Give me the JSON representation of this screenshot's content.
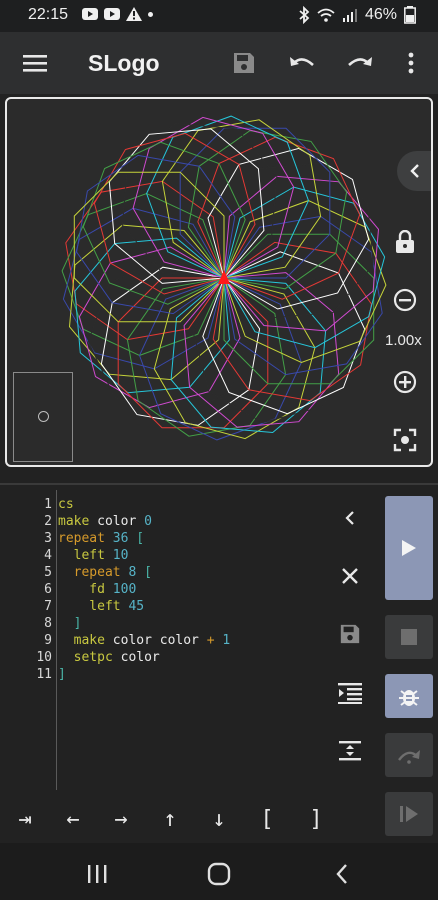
{
  "status": {
    "time": "22:15",
    "battery": "46%",
    "left_icons": [
      "youtube-icon",
      "youtube-icon",
      "warning-icon",
      "dot-icon"
    ],
    "right_icons": [
      "bluetooth-icon",
      "wifi-icon",
      "signal-icon",
      "battery-icon"
    ]
  },
  "appbar": {
    "title": "SLogo",
    "icons": [
      "menu-icon",
      "save-icon",
      "undo-icon",
      "redo-icon",
      "more-vert-icon"
    ]
  },
  "canvas": {
    "zoom": "1.00x",
    "colors": [
      "#e53935",
      "#43a047",
      "#3949ab",
      "#c6d43a",
      "#26c6da",
      "#d14ad1",
      "#2c2c2c",
      "#ffffff"
    ],
    "turtle_color": "#ff1a1a",
    "repeat_outer": 36,
    "left_angle": 10,
    "repeat_inner": 8,
    "forward": 100,
    "turn": 45
  },
  "editor": {
    "lines": [
      {
        "num": "1",
        "tokens": [
          {
            "t": "cs",
            "c": "kw"
          }
        ]
      },
      {
        "num": "2",
        "tokens": [
          {
            "t": "make",
            "c": "kw"
          },
          {
            "t": " color ",
            "c": "w"
          },
          {
            "t": "0",
            "c": "n"
          }
        ]
      },
      {
        "num": "3",
        "tokens": [
          {
            "t": "repeat",
            "c": "cmd"
          },
          {
            "t": " ",
            "c": "w"
          },
          {
            "t": "36",
            "c": "n"
          },
          {
            "t": " [",
            "c": "br"
          }
        ]
      },
      {
        "num": "4",
        "tokens": [
          {
            "t": "  left",
            "c": "kw"
          },
          {
            "t": " ",
            "c": "w"
          },
          {
            "t": "10",
            "c": "n"
          }
        ]
      },
      {
        "num": "5",
        "tokens": [
          {
            "t": "  repeat",
            "c": "cmd"
          },
          {
            "t": " ",
            "c": "w"
          },
          {
            "t": "8",
            "c": "n"
          },
          {
            "t": " [",
            "c": "br"
          }
        ]
      },
      {
        "num": "6",
        "tokens": [
          {
            "t": "    fd",
            "c": "kw"
          },
          {
            "t": " ",
            "c": "w"
          },
          {
            "t": "100",
            "c": "n"
          }
        ]
      },
      {
        "num": "7",
        "tokens": [
          {
            "t": "    left",
            "c": "kw"
          },
          {
            "t": " ",
            "c": "w"
          },
          {
            "t": "45",
            "c": "n"
          }
        ]
      },
      {
        "num": "8",
        "tokens": [
          {
            "t": "  ]",
            "c": "br"
          }
        ]
      },
      {
        "num": "9",
        "tokens": [
          {
            "t": "  make",
            "c": "kw"
          },
          {
            "t": " color color ",
            "c": "w"
          },
          {
            "t": "+",
            "c": "cmd"
          },
          {
            "t": " ",
            "c": "w"
          },
          {
            "t": "1",
            "c": "n"
          }
        ]
      },
      {
        "num": "10",
        "tokens": [
          {
            "t": "  setpc",
            "c": "kw"
          },
          {
            "t": " color",
            "c": "w"
          }
        ]
      },
      {
        "num": "11",
        "tokens": [
          {
            "t": "]",
            "c": "br"
          }
        ]
      }
    ]
  },
  "side_tools": [
    "chevron-left-icon",
    "close-icon",
    "save-icon",
    "indent-icon",
    "line-spacing-icon"
  ],
  "run_tools": [
    "play-icon",
    "stop-icon",
    "debug-icon",
    "step-over-icon",
    "step-icon"
  ],
  "keys": [
    "⇥",
    "←",
    "→",
    "↑",
    "↓",
    "[",
    "]"
  ],
  "nav": [
    "recents-icon",
    "home-icon",
    "back-icon"
  ]
}
